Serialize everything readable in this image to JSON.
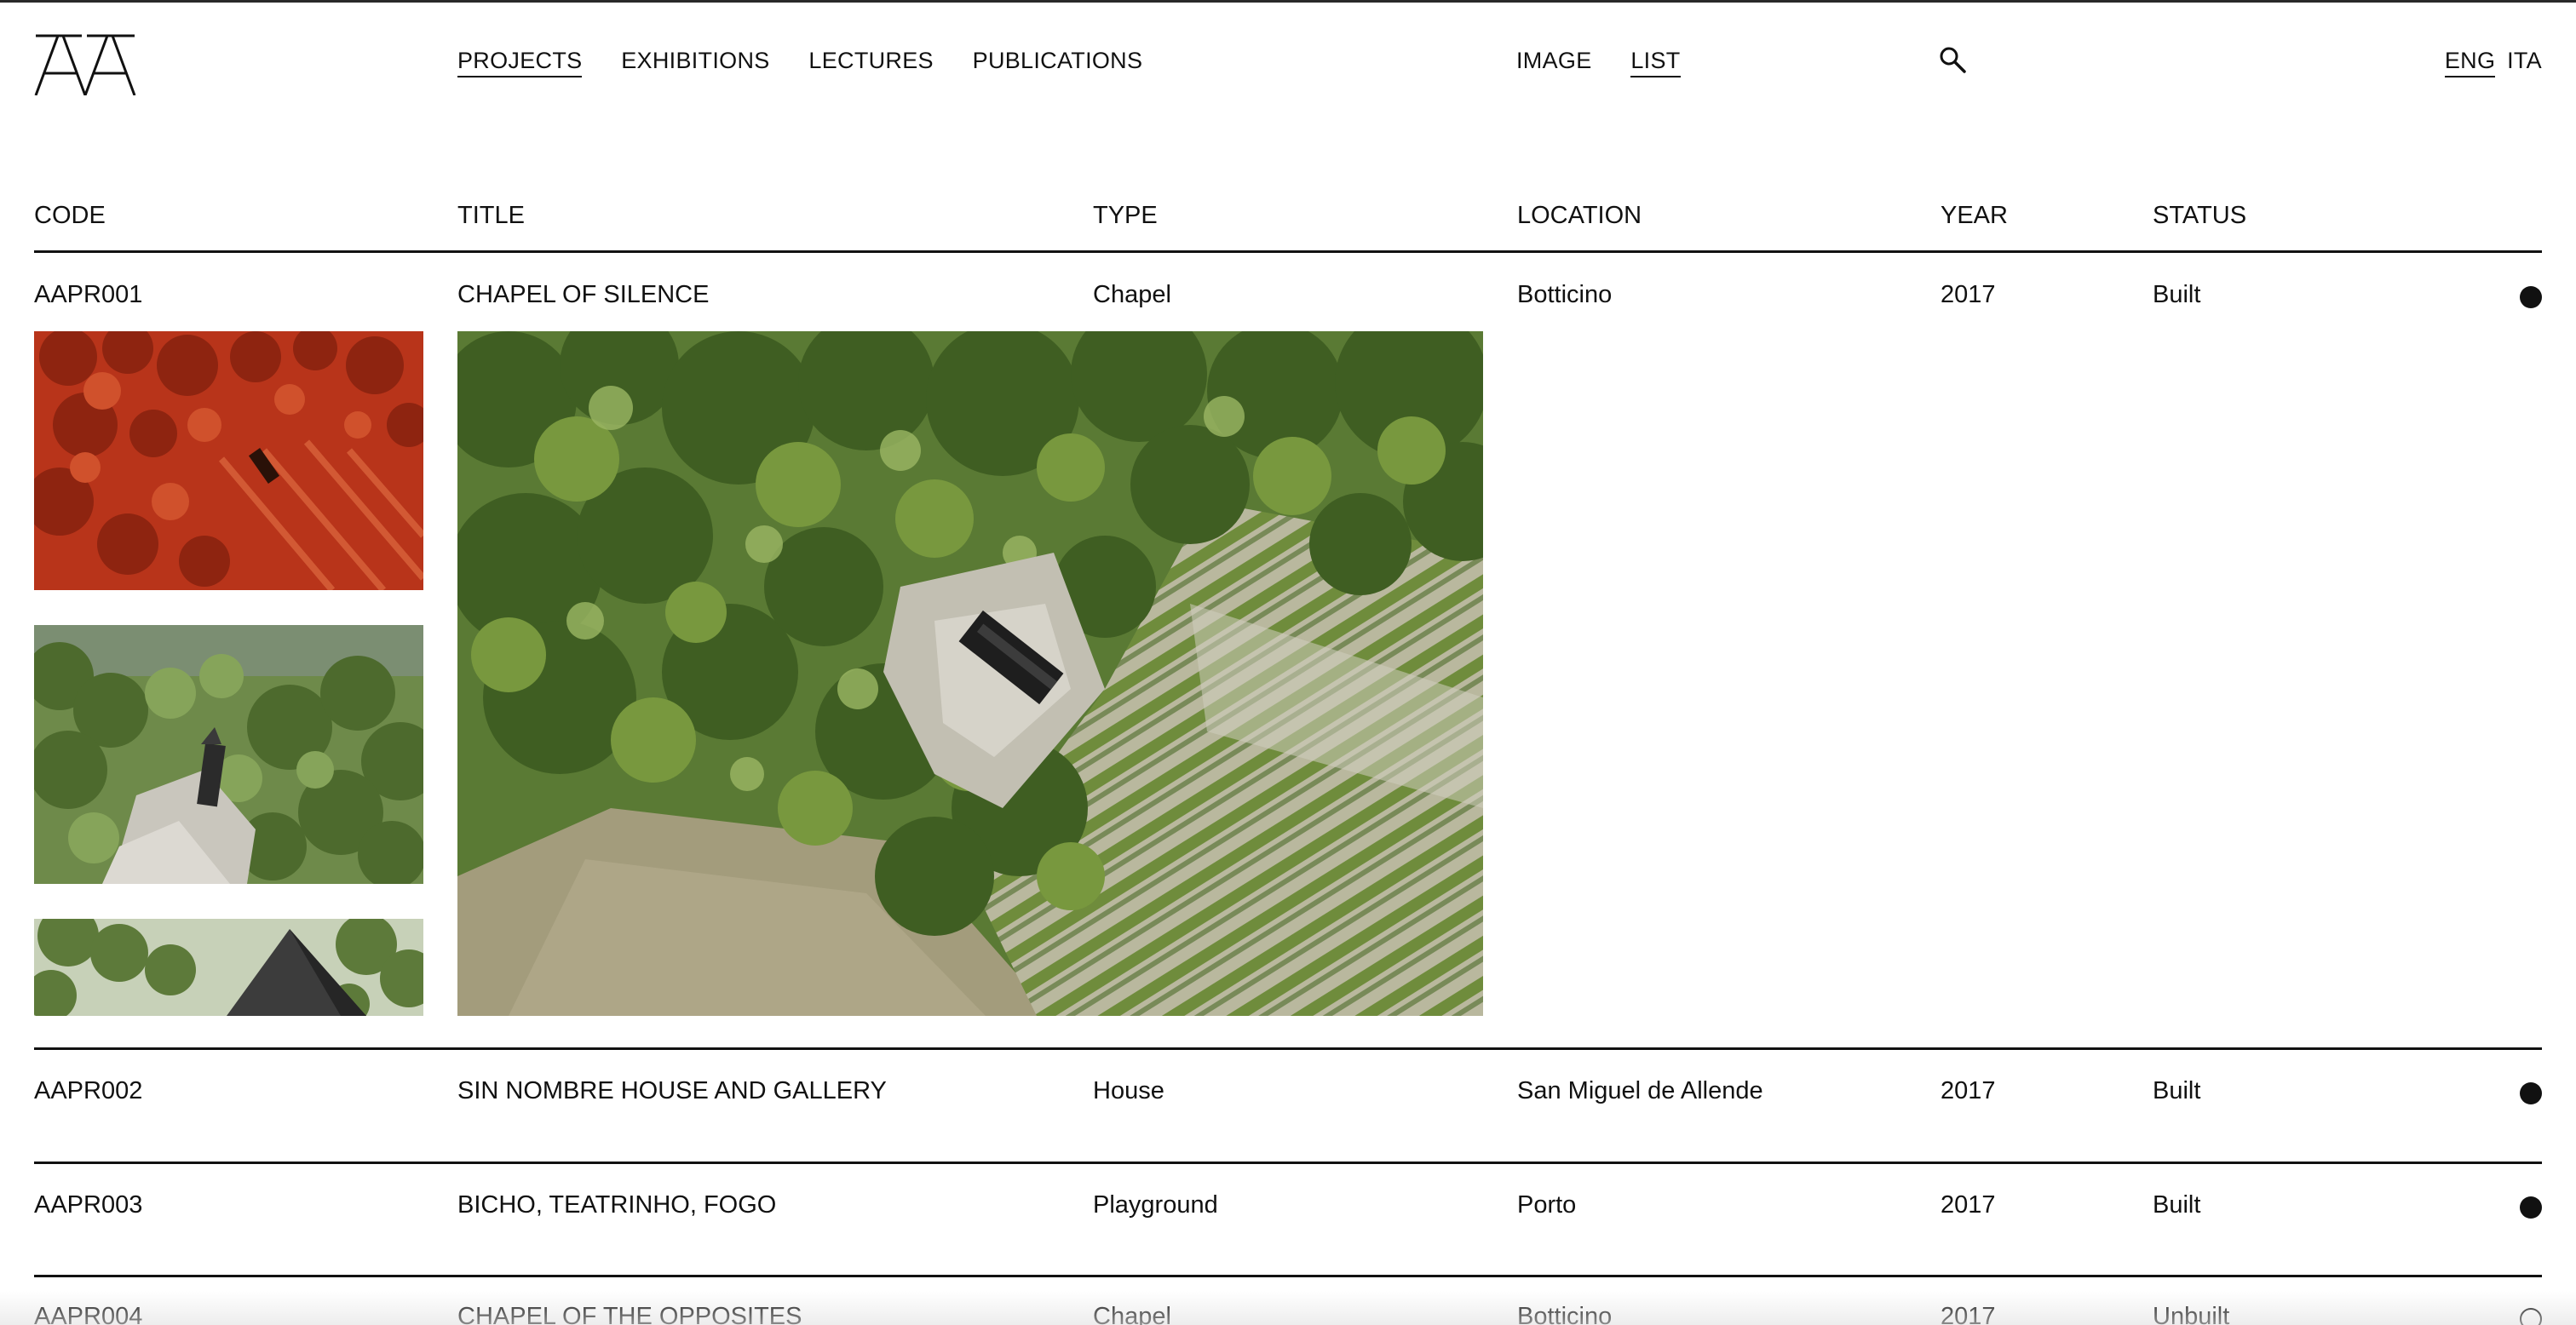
{
  "header": {
    "logo_text": "AA",
    "main_nav": [
      {
        "label": "PROJECTS",
        "active": true
      },
      {
        "label": "EXHIBITIONS",
        "active": false
      },
      {
        "label": "LECTURES",
        "active": false
      },
      {
        "label": "PUBLICATIONS",
        "active": false
      }
    ],
    "view_nav": [
      {
        "label": "IMAGE",
        "active": false
      },
      {
        "label": "LIST",
        "active": true
      }
    ],
    "search_icon": "search-icon",
    "lang_nav": [
      {
        "label": "ENG",
        "active": true
      },
      {
        "label": "ITA",
        "active": false
      }
    ]
  },
  "table": {
    "columns": [
      "CODE",
      "TITLE",
      "TYPE",
      "LOCATION",
      "YEAR",
      "STATUS"
    ],
    "rows": [
      {
        "code": "AAPR001",
        "title": "CHAPEL OF SILENCE",
        "type": "Chapel",
        "location": "Botticino",
        "year": "2017",
        "status": "Built",
        "indicator": "filled-dot"
      },
      {
        "code": "AAPR002",
        "title": "SIN NOMBRE HOUSE AND GALLERY",
        "type": "House",
        "location": "San Miguel de Allende",
        "year": "2017",
        "status": "Built",
        "indicator": "filled-dot"
      },
      {
        "code": "AAPR003",
        "title": "BICHO, TEATRINHO, FOGO",
        "type": "Playground",
        "location": "Porto",
        "year": "2017",
        "status": "Built",
        "indicator": "filled-dot"
      },
      {
        "code": "AAPR004",
        "title": "CHAPEL OF THE OPPOSITES",
        "type": "Chapel",
        "location": "Botticino",
        "year": "2017",
        "status": "Unbuilt",
        "indicator": "hollow-dot"
      }
    ]
  },
  "colors": {
    "text": "#111111",
    "background": "#ffffff",
    "thumb1_red": "#b8341a",
    "foliage_green": "#5f7d3a"
  }
}
